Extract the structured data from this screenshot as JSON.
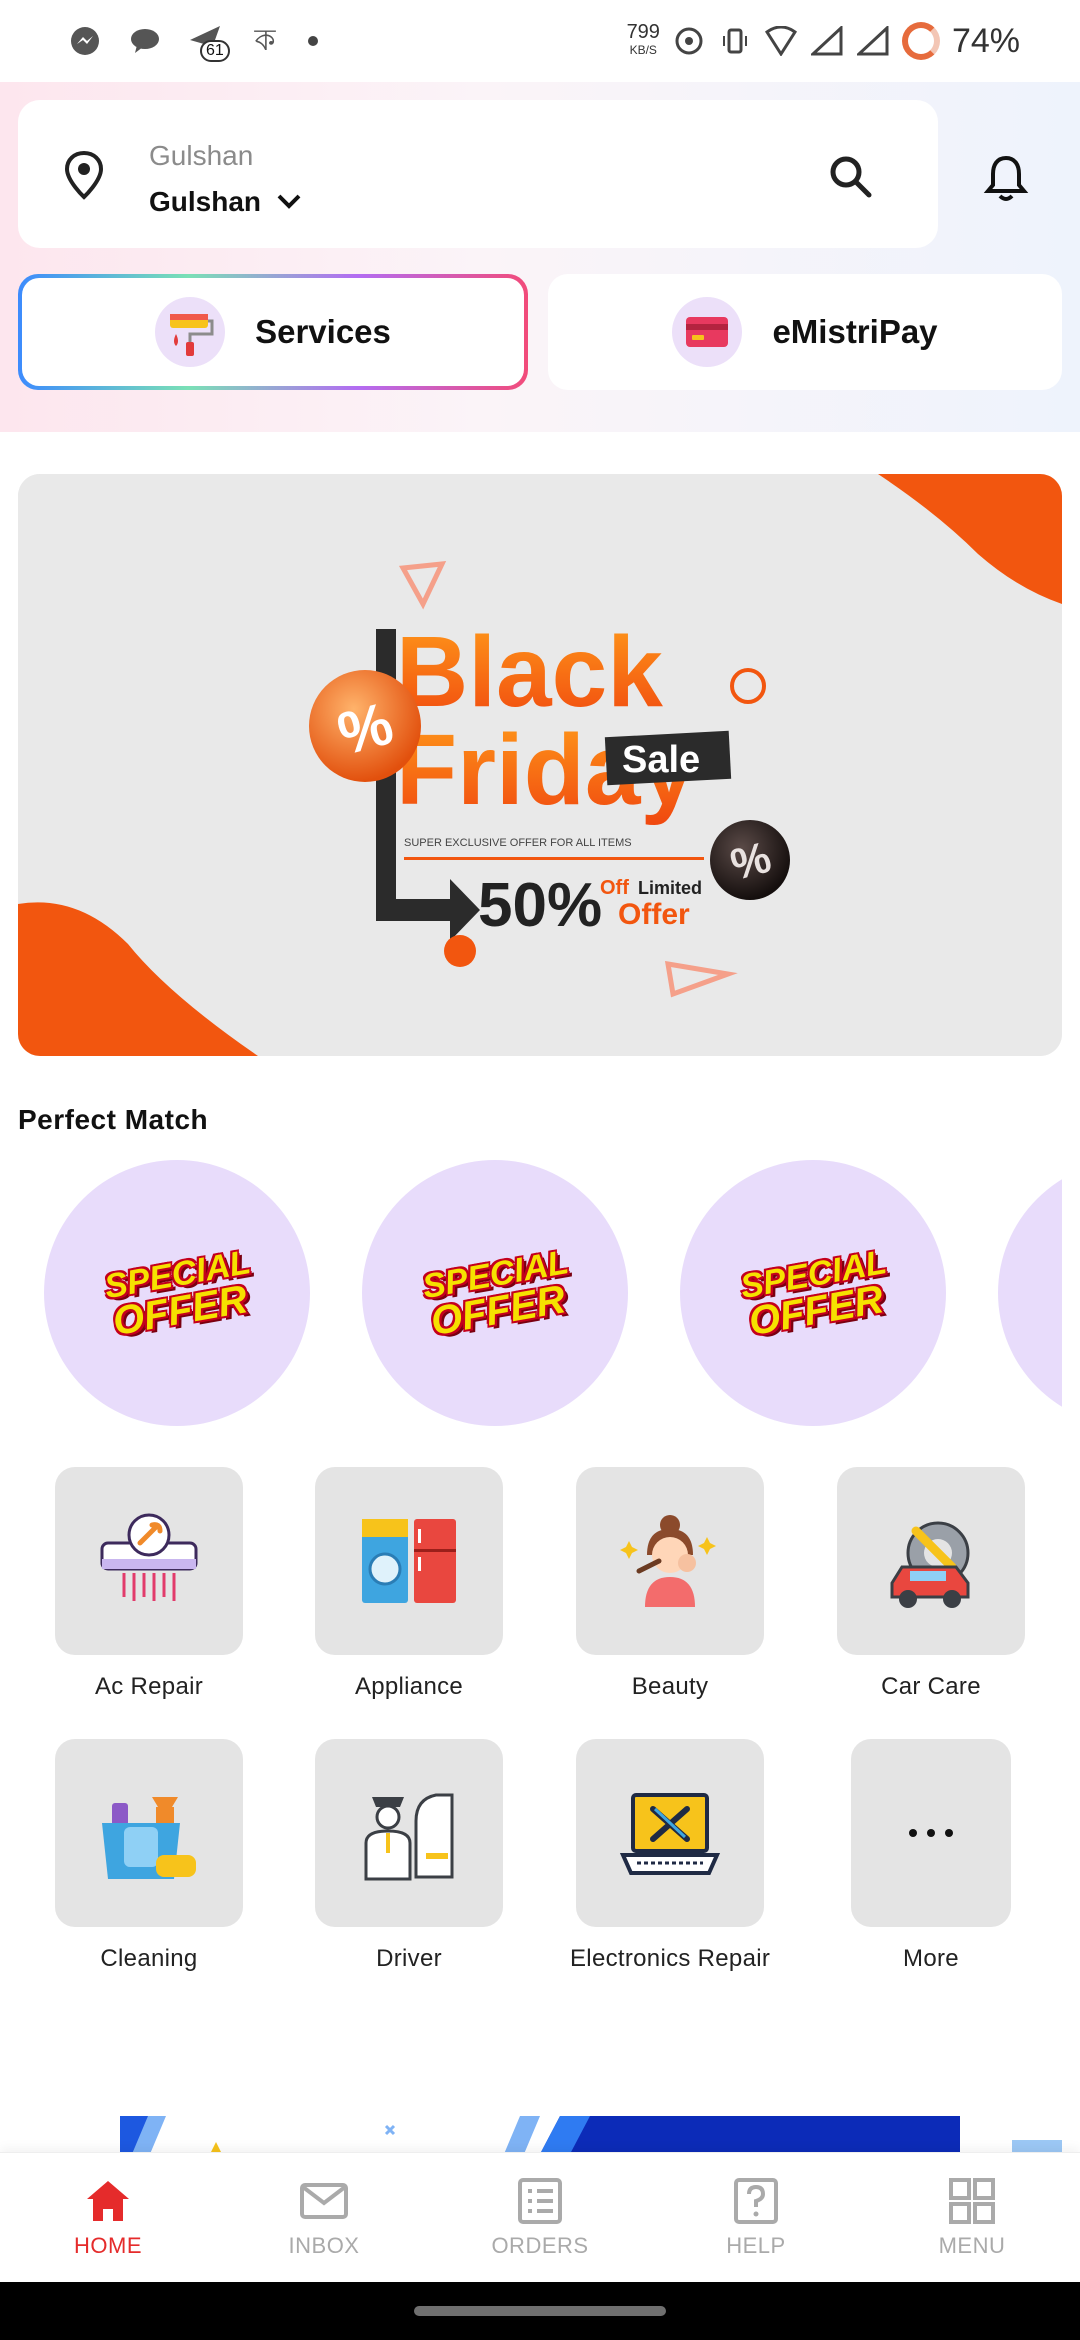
{
  "status_bar": {
    "notification_badge": "61",
    "net_speed": "799",
    "net_unit": "KB/S",
    "battery": "74%"
  },
  "location": {
    "label": "Gulshan",
    "value": "Gulshan"
  },
  "tabs": [
    {
      "label": "Services",
      "icon": "paint-roller-icon"
    },
    {
      "label": "eMistriPay",
      "icon": "credit-card-icon"
    }
  ],
  "banner": {
    "line1": "Black",
    "line2": "Friday",
    "sale": "Sale",
    "tagline": "SUPER EXCLUSIVE OFFER FOR ALL ITEMS",
    "discount": "50%",
    "off": "Off",
    "limited": "Limited",
    "offer": "Offer"
  },
  "perfect_match": {
    "title": "Perfect Match",
    "items": [
      {
        "line1": "SPECIAL",
        "line2": "OFFER"
      },
      {
        "line1": "SPECIAL",
        "line2": "OFFER"
      },
      {
        "line1": "SPECIAL",
        "line2": "OFFER"
      }
    ]
  },
  "categories": [
    {
      "label": "Ac Repair",
      "icon": "ac-repair-icon"
    },
    {
      "label": "Appliance",
      "icon": "appliance-icon"
    },
    {
      "label": "Beauty",
      "icon": "beauty-icon"
    },
    {
      "label": "Car Care",
      "icon": "car-care-icon"
    },
    {
      "label": "Cleaning",
      "icon": "cleaning-icon"
    },
    {
      "label": "Driver",
      "icon": "driver-icon"
    },
    {
      "label": "Electronics Repair",
      "icon": "electronics-repair-icon"
    },
    {
      "label": "More",
      "icon": "more-dots-icon"
    }
  ],
  "bottom_nav": [
    {
      "label": "HOME",
      "active": true,
      "icon": "home-icon"
    },
    {
      "label": "INBOX",
      "active": false,
      "icon": "mail-icon"
    },
    {
      "label": "ORDERS",
      "active": false,
      "icon": "orders-list-icon"
    },
    {
      "label": "HELP",
      "active": false,
      "icon": "help-icon"
    },
    {
      "label": "MENU",
      "active": false,
      "icon": "grid-menu-icon"
    }
  ],
  "colors": {
    "accent": "#e52b2b",
    "offer_circle": "#e8dcfb",
    "category_box": "#e4e4e4",
    "banner_orange": "#f26a1b"
  }
}
